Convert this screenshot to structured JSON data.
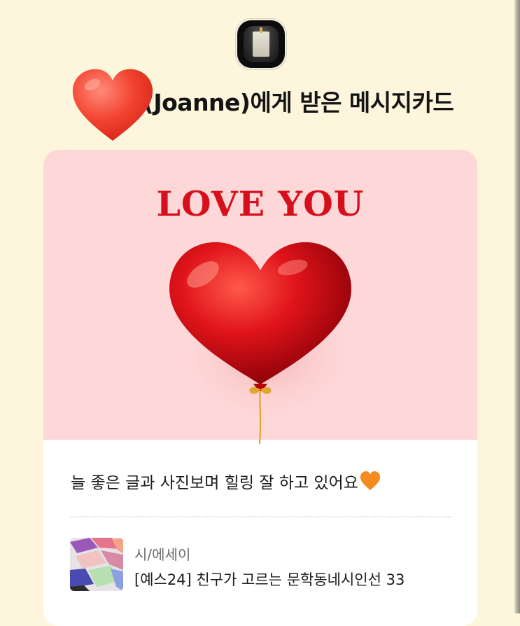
{
  "header": {
    "title": "(Joanne)에게 받은 메시지카드",
    "avatar_icon": "profile-photo-icon",
    "sticker_icon": "red-heart-icon"
  },
  "card": {
    "headline": "LOVE YOU",
    "image_icon": "red-heart-balloon-icon",
    "message": "늘 좋은 글과 사진보며 힐링 잘 하고 있어요",
    "message_emoji": "orange-heart-icon",
    "book": {
      "category": "시/에세이",
      "title": "[예스24] 친구가 고르는 문학동네시인선 33",
      "thumb_icon": "book-cover-icon"
    }
  },
  "colors": {
    "background": "#fdf6dc",
    "card_image_bg": "#fed8d9",
    "headline": "#d5101c",
    "card_bg": "#ffffff"
  }
}
